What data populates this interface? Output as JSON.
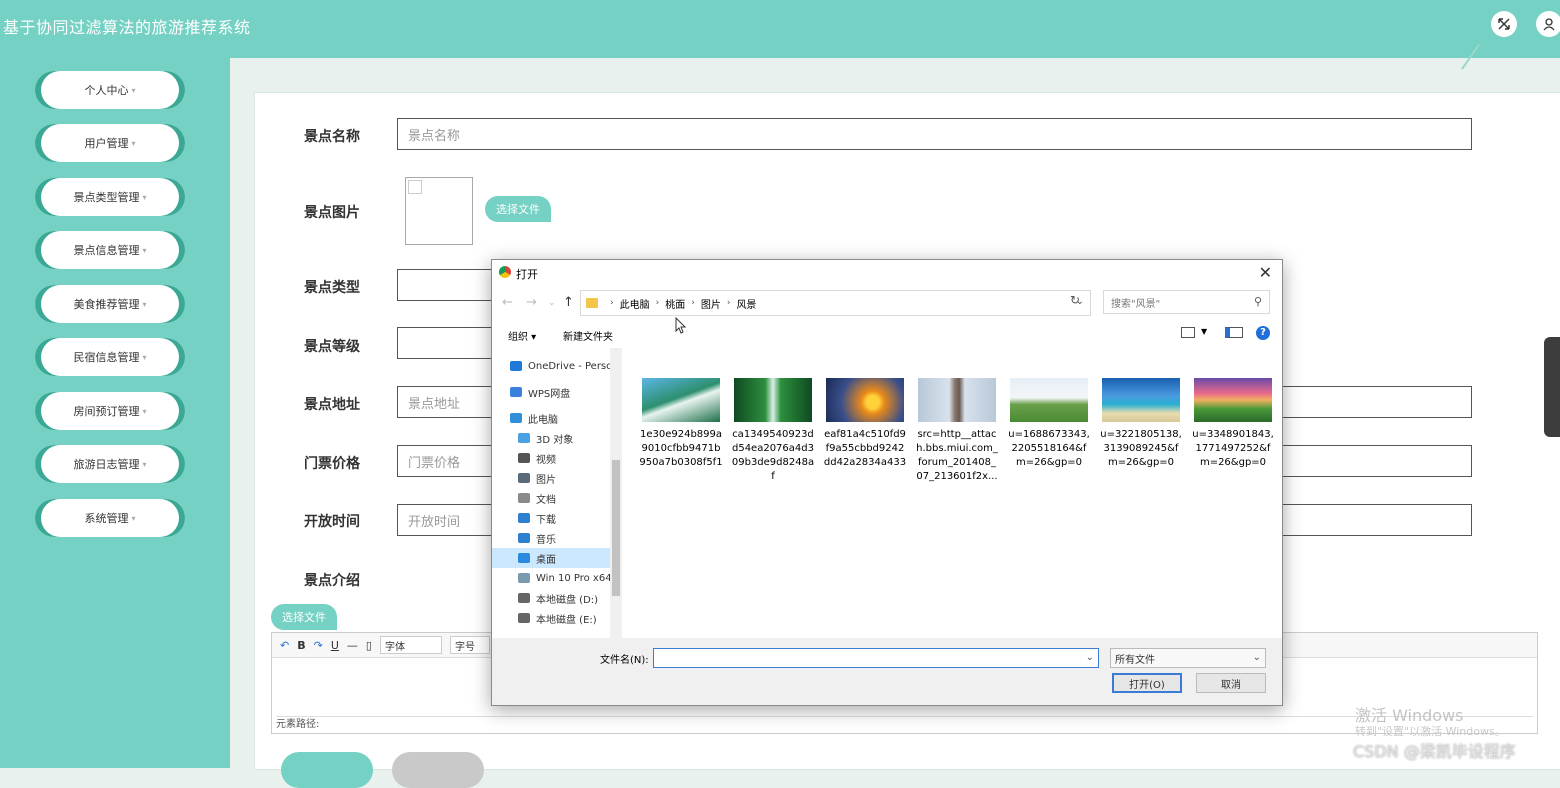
{
  "header": {
    "title": "基于协同过滤算法的旅游推荐系统"
  },
  "sidebar": {
    "items": [
      {
        "label": "个人中心"
      },
      {
        "label": "用户管理"
      },
      {
        "label": "景点类型管理"
      },
      {
        "label": "景点信息管理"
      },
      {
        "label": "美食推荐管理"
      },
      {
        "label": "民宿信息管理"
      },
      {
        "label": "房间预订管理"
      },
      {
        "label": "旅游日志管理"
      },
      {
        "label": "系统管理"
      }
    ],
    "caret": "▾"
  },
  "form": {
    "name": {
      "label": "景点名称",
      "placeholder": "景点名称"
    },
    "image": {
      "label": "景点图片",
      "button": "选择文件"
    },
    "type": {
      "label": "景点类型"
    },
    "level": {
      "label": "景点等级"
    },
    "address": {
      "label": "景点地址",
      "placeholder": "景点地址"
    },
    "price": {
      "label": "门票价格",
      "placeholder": "门票价格"
    },
    "open_time": {
      "label": "开放时间",
      "placeholder": "开放时间"
    },
    "intro": {
      "label": "景点介绍",
      "button": "选择文件"
    }
  },
  "editor": {
    "font_label": "字体",
    "size_label": "字号",
    "path_label": "元素路径:"
  },
  "dialog": {
    "title": "打开",
    "breadcrumb": [
      "此电脑",
      "桃面",
      "图片",
      "风景"
    ],
    "search_placeholder": "搜索\"风景\"",
    "organize": "组织 ▾",
    "new_folder": "新建文件夹",
    "nav_items": [
      {
        "label": "OneDrive - Perso",
        "icon_color": "#1e7ad8"
      },
      {
        "label": "WPS网盘",
        "icon_color": "#3a80e0"
      },
      {
        "label": "此电脑",
        "icon_color": "#2f8fd8"
      },
      {
        "label": "3D 对象",
        "icon_color": "#4aa0e0"
      },
      {
        "label": "视频",
        "icon_color": "#555555"
      },
      {
        "label": "图片",
        "icon_color": "#5a6a7a"
      },
      {
        "label": "文档",
        "icon_color": "#8a8a8a"
      },
      {
        "label": "下载",
        "icon_color": "#2f7fd0"
      },
      {
        "label": "音乐",
        "icon_color": "#2f7fd0"
      },
      {
        "label": "桌面",
        "icon_color": "#2a8ae0"
      },
      {
        "label": "Win 10 Pro x64",
        "icon_color": "#7a9ab0"
      },
      {
        "label": "本地磁盘 (D:)",
        "icon_color": "#666666"
      },
      {
        "label": "本地磁盘 (E:)",
        "icon_color": "#666666"
      }
    ],
    "files": [
      {
        "name": "1e30e924b899a9010cfbb9471b950a7b0308f5f1"
      },
      {
        "name": "ca1349540923dd54ea2076a4d309b3de9d8248af"
      },
      {
        "name": "eaf81a4c510fd9f9a55cbbd9242dd42a2834a433"
      },
      {
        "name": "src=http__attach.bbs.miui.com_forum_201408_07_213601f2x..."
      },
      {
        "name": "u=1688673343,2205518164&fm=26&gp=0"
      },
      {
        "name": "u=3221805138,3139089245&fm=26&gp=0"
      },
      {
        "name": "u=3348901843,1771497252&fm=26&gp=0"
      }
    ],
    "filename_label": "文件名(N):",
    "filetype": "所有文件",
    "open_button": "打开(O)",
    "cancel_button": "取消"
  },
  "watermark": {
    "line1": "激活 Windows",
    "line2": "转到\"设置\"以激活 Windows。",
    "csdn": "CSDN @梁凯毕设程序"
  }
}
